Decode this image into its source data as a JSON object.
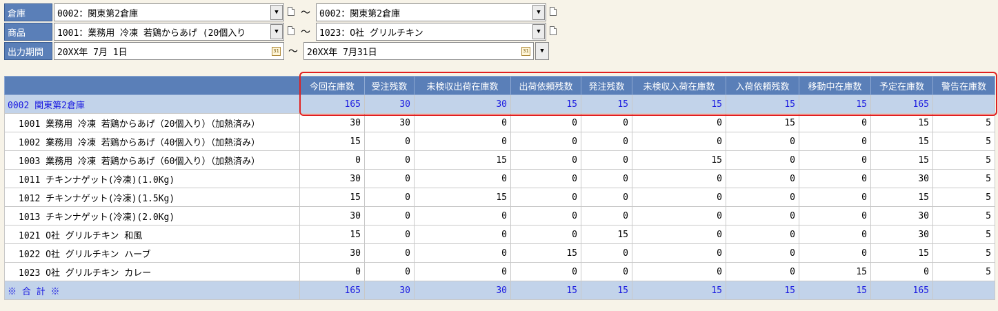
{
  "filters": [
    {
      "label": "倉庫",
      "from": "0002：関東第2倉庫",
      "to": "0002：関東第2倉庫",
      "type": "combo"
    },
    {
      "label": "商品",
      "from": "1001：業務用 冷凍 若鶏からあげ (20個入り",
      "to": "1023：O社 グリルチキン",
      "type": "combo"
    },
    {
      "label": "出力期間",
      "from": "20XX年 7月 1日",
      "to": "20XX年 7月31日",
      "type": "date"
    }
  ],
  "range_separator": "～",
  "columns": [
    "今回在庫数",
    "受注残数",
    "未検収出荷在庫数",
    "出荷依頼残数",
    "発注残数",
    "未検収入荷在庫数",
    "入荷依頼残数",
    "移動中在庫数",
    "予定在庫数",
    "警告在庫数"
  ],
  "group": {
    "name": "0002 関東第2倉庫",
    "values": [
      "165",
      "30",
      "30",
      "15",
      "15",
      "15",
      "15",
      "15",
      "165",
      ""
    ]
  },
  "rows": [
    {
      "name": "1001 業務用 冷凍 若鶏からあげ（20個入り）（加熱済み）",
      "values": [
        "30",
        "30",
        "0",
        "0",
        "0",
        "0",
        "15",
        "0",
        "15",
        "5"
      ]
    },
    {
      "name": "1002 業務用 冷凍 若鶏からあげ（40個入り）（加熱済み）",
      "values": [
        "15",
        "0",
        "0",
        "0",
        "0",
        "0",
        "0",
        "0",
        "15",
        "5"
      ]
    },
    {
      "name": "1003 業務用 冷凍 若鶏からあげ（60個入り）（加熱済み）",
      "values": [
        "0",
        "0",
        "15",
        "0",
        "0",
        "15",
        "0",
        "0",
        "15",
        "5"
      ]
    },
    {
      "name": "1011 チキンナゲット(冷凍)(1.0Kg)",
      "values": [
        "30",
        "0",
        "0",
        "0",
        "0",
        "0",
        "0",
        "0",
        "30",
        "5"
      ]
    },
    {
      "name": "1012 チキンナゲット(冷凍)(1.5Kg)",
      "values": [
        "15",
        "0",
        "15",
        "0",
        "0",
        "0",
        "0",
        "0",
        "15",
        "5"
      ]
    },
    {
      "name": "1013 チキンナゲット(冷凍)(2.0Kg)",
      "values": [
        "30",
        "0",
        "0",
        "0",
        "0",
        "0",
        "0",
        "0",
        "30",
        "5"
      ]
    },
    {
      "name": "1021 O社 グリルチキン 和風",
      "values": [
        "15",
        "0",
        "0",
        "0",
        "15",
        "0",
        "0",
        "0",
        "30",
        "5"
      ]
    },
    {
      "name": "1022 O社 グリルチキン ハーブ",
      "values": [
        "30",
        "0",
        "0",
        "15",
        "0",
        "0",
        "0",
        "0",
        "15",
        "5"
      ]
    },
    {
      "name": "1023 O社 グリルチキン カレー",
      "values": [
        "0",
        "0",
        "0",
        "0",
        "0",
        "0",
        "0",
        "15",
        "0",
        "5"
      ]
    }
  ],
  "total": {
    "name": "※ 合 計 ※",
    "values": [
      "165",
      "30",
      "30",
      "15",
      "15",
      "15",
      "15",
      "15",
      "165",
      ""
    ]
  },
  "colors": {
    "header_bg": "#5a7fb8",
    "group_bg": "#c2d3ea",
    "group_text": "#1a1ae0",
    "highlight": "#e02020"
  }
}
